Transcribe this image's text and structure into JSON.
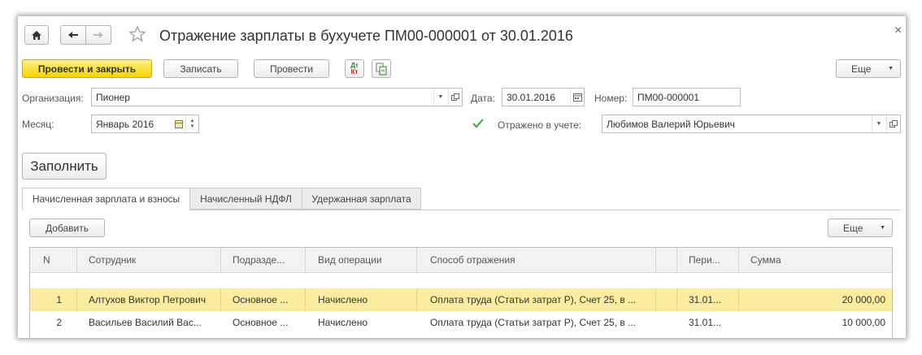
{
  "window": {
    "title": "Отражение зарплаты в бухучете ПМ00-000001 от 30.01.2016",
    "close": "×"
  },
  "toolbar": {
    "post_close": "Провести и закрыть",
    "save": "Записать",
    "post": "Провести",
    "more": "Еще",
    "dt_kt_top": "Дт",
    "dt_kt_bottom": "Кт"
  },
  "form": {
    "org_label": "Организация:",
    "org_value": "Пионер",
    "date_label": "Дата:",
    "date_value": "30.01.2016",
    "number_label": "Номер:",
    "number_value": "ПМ00-000001",
    "month_label": "Месяц:",
    "month_value": "Январь 2016",
    "reflected_label": "Отражено в учете:",
    "reflected_checked": true,
    "person_value": "Любимов Валерий Юрьевич"
  },
  "fill_button": "Заполнить",
  "tabs": [
    {
      "label": "Начисленная зарплата и взносы",
      "active": true
    },
    {
      "label": "Начисленный НДФЛ",
      "active": false
    },
    {
      "label": "Удержанная зарплата",
      "active": false
    }
  ],
  "table_toolbar": {
    "add": "Добавить",
    "more": "Еще"
  },
  "table": {
    "columns": [
      "N",
      "Сотрудник",
      "Подразде...",
      "Вид операции",
      "Способ отражения",
      "",
      "Пери...",
      "Сумма"
    ],
    "rows": [
      {
        "n": "1",
        "employee": "Алтухов Виктор Петрович",
        "dept": "Основное ...",
        "op": "Начислено",
        "method": "Оплата труда (Статьи затрат Р), Счет 25, в ...",
        "period": "31.01...",
        "sum": "20 000,00",
        "selected": true
      },
      {
        "n": "2",
        "employee": "Васильев Василий Вас...",
        "dept": "Основное ...",
        "op": "Начислено",
        "method": "Оплата труда (Статьи затрат Р), Счет 25, в ...",
        "period": "31.01...",
        "sum": "10 000,00",
        "selected": false
      }
    ]
  },
  "colors": {
    "primary_button": "#f5d400",
    "selected_row": "#fbeca0",
    "checkbox": "#3aa63a"
  }
}
